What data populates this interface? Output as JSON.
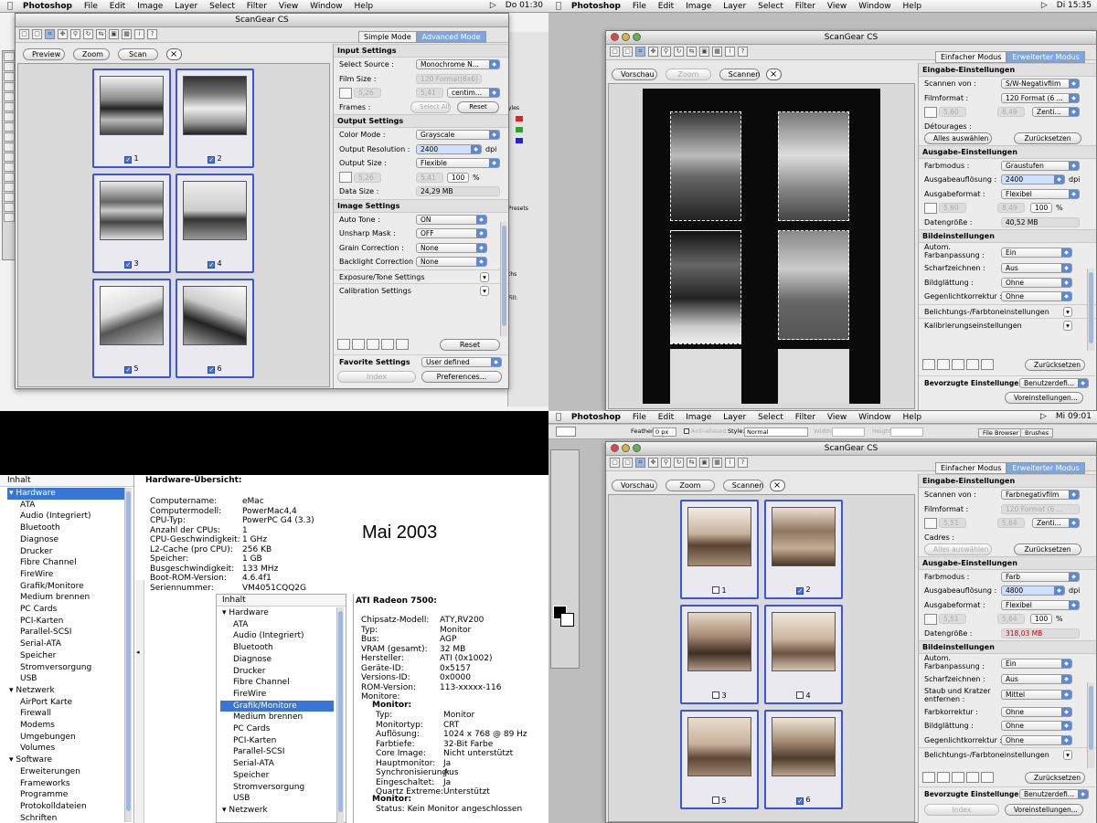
{
  "top_left": {
    "menubar": {
      "app": "Photoshop",
      "items": [
        "File",
        "Edit",
        "Image",
        "Layer",
        "Select",
        "Filter",
        "View",
        "Window",
        "Help"
      ],
      "clock": "Do 01:30"
    },
    "window_title": "ScanGear CS",
    "mode_tabs": [
      "Simple Mode",
      "Advanced Mode"
    ],
    "buttons": {
      "preview": "Preview",
      "zoom": "Zoom",
      "scan": "Scan",
      "close": "×"
    },
    "thumbs": [
      "1",
      "2",
      "3",
      "4",
      "5",
      "6"
    ],
    "input_settings": {
      "header": "Input Settings",
      "select_source_label": "Select Source :",
      "select_source": "Monochrome N...",
      "film_size_label": "Film Size :",
      "film_size": "120 Format(6x6)",
      "w": "5,26",
      "h": "5,41",
      "unit": "centim...",
      "frames_label": "Frames :",
      "select_all": "Select All",
      "reset": "Reset"
    },
    "output_settings": {
      "header": "Output Settings",
      "color_mode_label": "Color Mode :",
      "color_mode": "Grayscale",
      "resolution_label": "Output Resolution :",
      "resolution": "2400",
      "dpi": "dpi",
      "size_label": "Output Size :",
      "size": "Flexible",
      "w": "5,26",
      "h": "5,41",
      "pct": "100",
      "pct_sign": "%",
      "data_size_label": "Data Size :",
      "data_size": "24,29 MB"
    },
    "image_settings": {
      "header": "Image Settings",
      "auto_tone_label": "Auto Tone :",
      "auto_tone": "ON",
      "unsharp_label": "Unsharp Mask :",
      "unsharp": "OFF",
      "grain_label": "Grain Correction :",
      "grain": "None",
      "backlight_label": "Backlight Correction :",
      "backlight": "None",
      "exposure": "Exposure/Tone Settings",
      "calibration": "Calibration Settings"
    },
    "reset2": "Reset",
    "favorite_label": "Favorite Settings",
    "favorite": "User defined",
    "index": "Index",
    "preferences": "Preferences...",
    "bg_labels": {
      "styles": "yles",
      "presets": "Presets",
      "paths": "ths",
      "fill": "Fill:"
    }
  },
  "top_right": {
    "menubar": {
      "app": "Photoshop",
      "items": [
        "File",
        "Edit",
        "Image",
        "Layer",
        "Select",
        "Filter",
        "View",
        "Window",
        "Help"
      ],
      "clock": "Di 15:35"
    },
    "window_title": "ScanGear CS",
    "mode_tabs": [
      "Einfacher Modus",
      "Erweiterter Modus"
    ],
    "buttons": {
      "preview": "Vorschau",
      "zoom": "Zoom",
      "scan": "Scannen",
      "close": "×"
    },
    "input_header": "Eingabe-Einstellungen",
    "scan_from_label": "Scannen von :",
    "scan_from": "S/W-Negativfilm",
    "film_label": "Filmformat :",
    "film": "120 Format (6 ...",
    "in_w": "5,60",
    "in_h": "8,49",
    "unit": "Zenti...",
    "detourages_label": "Détourages :",
    "select_all": "Alles auswählen",
    "reset": "Zurücksetzen",
    "output_header": "Ausgabe-Einstellungen",
    "color_label": "Farbmodus :",
    "color": "Graustufen",
    "res_label": "Ausgabeauflösung :",
    "res": "2400",
    "dpi": "dpi",
    "fmt_label": "Ausgabeformat :",
    "fmt": "Flexibel",
    "out_w": "5,60",
    "out_h": "8,49",
    "pct": "100",
    "pct_sign": "%",
    "data_label": "Datengröße :",
    "data": "40,52 MB",
    "image_header": "Bildeinstellungen",
    "auto_label": "Autom. Farbanpassung :",
    "auto": "Ein",
    "sharp_label": "Scharfzeichnen :",
    "sharp": "Aus",
    "smooth_label": "Bildglättung :",
    "smooth": "Ohne",
    "backlight_label": "Gegenlichtkorrektur :",
    "backlight": "Ohne",
    "exposure": "Belichtungs-/Farbtoneinstellungen",
    "calibration": "Kalibrierungseinstellungen",
    "reset2": "Zurücksetzen",
    "fav_label": "Bevorzugte Einstellungen",
    "fav": "Benutzerdefi...",
    "prefs": "Voreinstellungen..."
  },
  "bottom_left": {
    "tree_header": "Inhalt",
    "tree": [
      "Hardware",
      "ATA",
      "Audio (Integriert)",
      "Bluetooth",
      "Diagnose",
      "Drucker",
      "Fibre Channel",
      "FireWire",
      "Grafik/Monitore",
      "Medium brennen",
      "PC Cards",
      "PCI-Karten",
      "Parallel-SCSI",
      "Serial-ATA",
      "Speicher",
      "Stromversorgung",
      "USB",
      "Netzwerk",
      "AirPort Karte",
      "Firewall",
      "Modems",
      "Umgebungen",
      "Volumes",
      "Software",
      "Erweiterungen",
      "Frameworks",
      "Programme",
      "Protokolldateien",
      "Schriften"
    ],
    "overview_title": "Hardware-Übersicht:",
    "overview": [
      [
        "Computername:",
        "eMac"
      ],
      [
        "Computermodell:",
        "PowerMac4,4"
      ],
      [
        "CPU-Typ:",
        "PowerPC G4  (3.3)"
      ],
      [
        "Anzahl der CPUs:",
        "1"
      ],
      [
        "CPU-Geschwindigkeit:",
        "1 GHz"
      ],
      [
        "L2-Cache (pro CPU):",
        "256 KB"
      ],
      [
        "Speicher:",
        "1 GB"
      ],
      [
        "Busgeschwindigkeit:",
        "133 MHz"
      ],
      [
        "Boot-ROM-Version:",
        "4.6.4f1"
      ],
      [
        "Seriennummer:",
        "VM4051CQQ2G"
      ]
    ],
    "date_label": "Mai 2003",
    "tree2_header": "Inhalt",
    "tree2": [
      "Hardware",
      "ATA",
      "Audio (Integriert)",
      "Bluetooth",
      "Diagnose",
      "Drucker",
      "Fibre Channel",
      "FireWire",
      "Grafik/Monitore",
      "Medium brennen",
      "PC Cards",
      "PCI-Karten",
      "Parallel-SCSI",
      "Serial-ATA",
      "Speicher",
      "Stromversorgung",
      "USB",
      "Netzwerk"
    ],
    "gpu_title": "ATI Radeon 7500:",
    "gpu": [
      [
        "Chipsatz-Modell:",
        "ATY,RV200"
      ],
      [
        "Typ:",
        "Monitor"
      ],
      [
        "Bus:",
        "AGP"
      ],
      [
        "VRAM (gesamt):",
        "32 MB"
      ],
      [
        "Hersteller:",
        "ATI (0x1002)"
      ],
      [
        "Geräte-ID:",
        "0x5157"
      ],
      [
        "Versions-ID:",
        "0x0000"
      ],
      [
        "ROM-Version:",
        "113-xxxxx-116"
      ],
      [
        "Monitore:",
        ""
      ]
    ],
    "monitor1_title": "Monitor:",
    "monitor1": [
      [
        "Typ:",
        "Monitor"
      ],
      [
        "Monitortyp:",
        "CRT"
      ],
      [
        "Auflösung:",
        "1024 x 768 @ 89 Hz"
      ],
      [
        "Farbtiefe:",
        "32-Bit Farbe"
      ],
      [
        "Core Image:",
        "Nicht unterstützt"
      ],
      [
        "Hauptmonitor:",
        "Ja"
      ],
      [
        "Synchronisierung:",
        "Aus"
      ],
      [
        "Eingeschaltet:",
        "Ja"
      ],
      [
        "Quartz Extreme:",
        "Unterstützt"
      ]
    ],
    "monitor2_title": "Monitor:",
    "monitor2_status_label": "Status:",
    "monitor2_status": "Kein Monitor angeschlossen"
  },
  "bottom_right": {
    "menubar": {
      "app": "Photoshop",
      "items": [
        "File",
        "Edit",
        "Image",
        "Layer",
        "Select",
        "Filter",
        "View",
        "Window",
        "Help"
      ],
      "clock": "Mi 09:01"
    },
    "options": {
      "feather_label": "Feather:",
      "feather": "0 px",
      "anti": "Anti-aliased",
      "style_label": "Style:",
      "style": "Normal",
      "width_label": "Width:",
      "height_label": "Height:",
      "file_browser": "File Browser",
      "brushes": "Brushes"
    },
    "window_title": "ScanGear CS",
    "mode_tabs": [
      "Einfacher Modus",
      "Erweiterter Modus"
    ],
    "buttons": {
      "preview": "Vorschau",
      "zoom": "Zoom",
      "scan": "Scannen",
      "close": "×"
    },
    "thumbs": [
      "1",
      "2",
      "3",
      "4",
      "5",
      "6"
    ],
    "input_header": "Eingabe-Einstellungen",
    "scan_from_label": "Scannen von :",
    "scan_from": "Farbnegativfilm",
    "film_label": "Filmformat :",
    "film": "120 Format (6 ...",
    "in_w": "5,51",
    "in_h": "5,64",
    "unit": "Zenti...",
    "cadres_label": "Cadres :",
    "select_all": "Alles auswählen",
    "reset": "Zurücksetzen",
    "output_header": "Ausgabe-Einstellungen",
    "color_label": "Farbmodus :",
    "color": "Farb",
    "res_label": "Ausgabeauflösung :",
    "res": "4800",
    "dpi": "dpi",
    "fmt_label": "Ausgabeformat :",
    "fmt": "Flexibel",
    "out_w": "5,51",
    "out_h": "5,64",
    "pct": "100",
    "pct_sign": "%",
    "data_label": "Datengröße :",
    "data": "318,03 MB",
    "image_header": "Bildeinstellungen",
    "auto_label": "Autom. Farbanpassung :",
    "auto": "Ein",
    "sharp_label": "Scharfzeichnen :",
    "sharp": "Aus",
    "dust_label": "Staub und Kratzer entfernen :",
    "dust": "Mittel",
    "color_corr_label": "Farbkorrektur :",
    "color_corr": "Ohne",
    "smooth_label": "Bildglättung :",
    "smooth": "Ohne",
    "backlight_label": "Gegenlichtkorrektur :",
    "backlight": "Ohne",
    "exposure": "Belichtungs-/Farbtoneinstellungen",
    "reset2": "Zurücksetzen",
    "fav_label": "Bevorzugte Einstellungen",
    "fav": "Benutzerdefi...",
    "index": "Index",
    "prefs": "Voreinstellungen..."
  },
  "colors": {
    "accent": "#3a55d8",
    "tab_active": "#7aa6e6",
    "selection": "#3875d7",
    "warning": "#c00000"
  }
}
